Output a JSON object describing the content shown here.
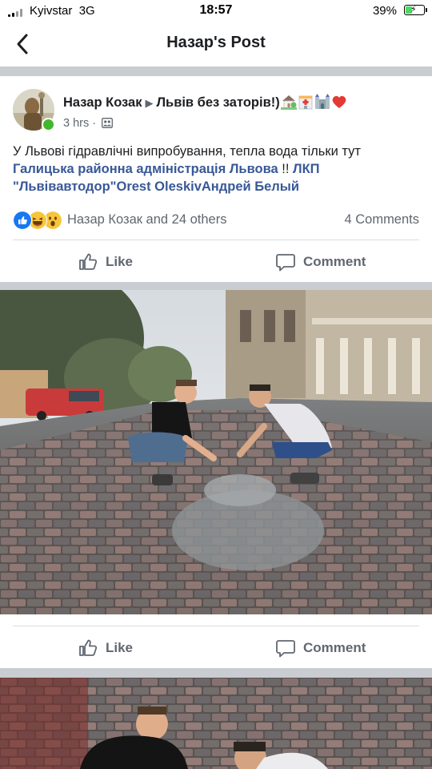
{
  "status_bar": {
    "carrier": "Kyivstar",
    "network": "3G",
    "time": "18:57",
    "battery": "39%",
    "battery_level": 0.39
  },
  "nav": {
    "title": "Назар's Post"
  },
  "post": {
    "author": "Назар Козак",
    "group": "Львів без заторів!)",
    "emojis": [
      "house-with-garden",
      "hospital",
      "castle",
      "red-heart"
    ],
    "time": "3 hrs",
    "text_plain": "У Львові гідравлічні випробування, тепла вода тільки тут",
    "tag_admin": "Галицька районна адміністрація Львова",
    "text_excl": " !! ",
    "tag_lkp": "ЛКП \"Львівавтодор\"",
    "tag_orest": "Orest Oleskiv",
    "tag_andrei": "Андрей Белый",
    "reactions": [
      "like",
      "haha",
      "wow"
    ],
    "reactors": "Назар Козак and 24 others",
    "comments_count": "4 Comments"
  },
  "actions": {
    "like": "Like",
    "comment": "Comment"
  },
  "photo_actions": {
    "like": "Like",
    "comment": "Comment"
  },
  "icons": {
    "back": "chevron-left-icon",
    "audience": "group-audience-icon",
    "like": "thumbs-up-icon",
    "comment": "speech-bubble-icon"
  },
  "colors": {
    "link": "#385898",
    "like_blue": "#1877f2",
    "online": "#42b72a",
    "separator": "#c9ccd1"
  }
}
